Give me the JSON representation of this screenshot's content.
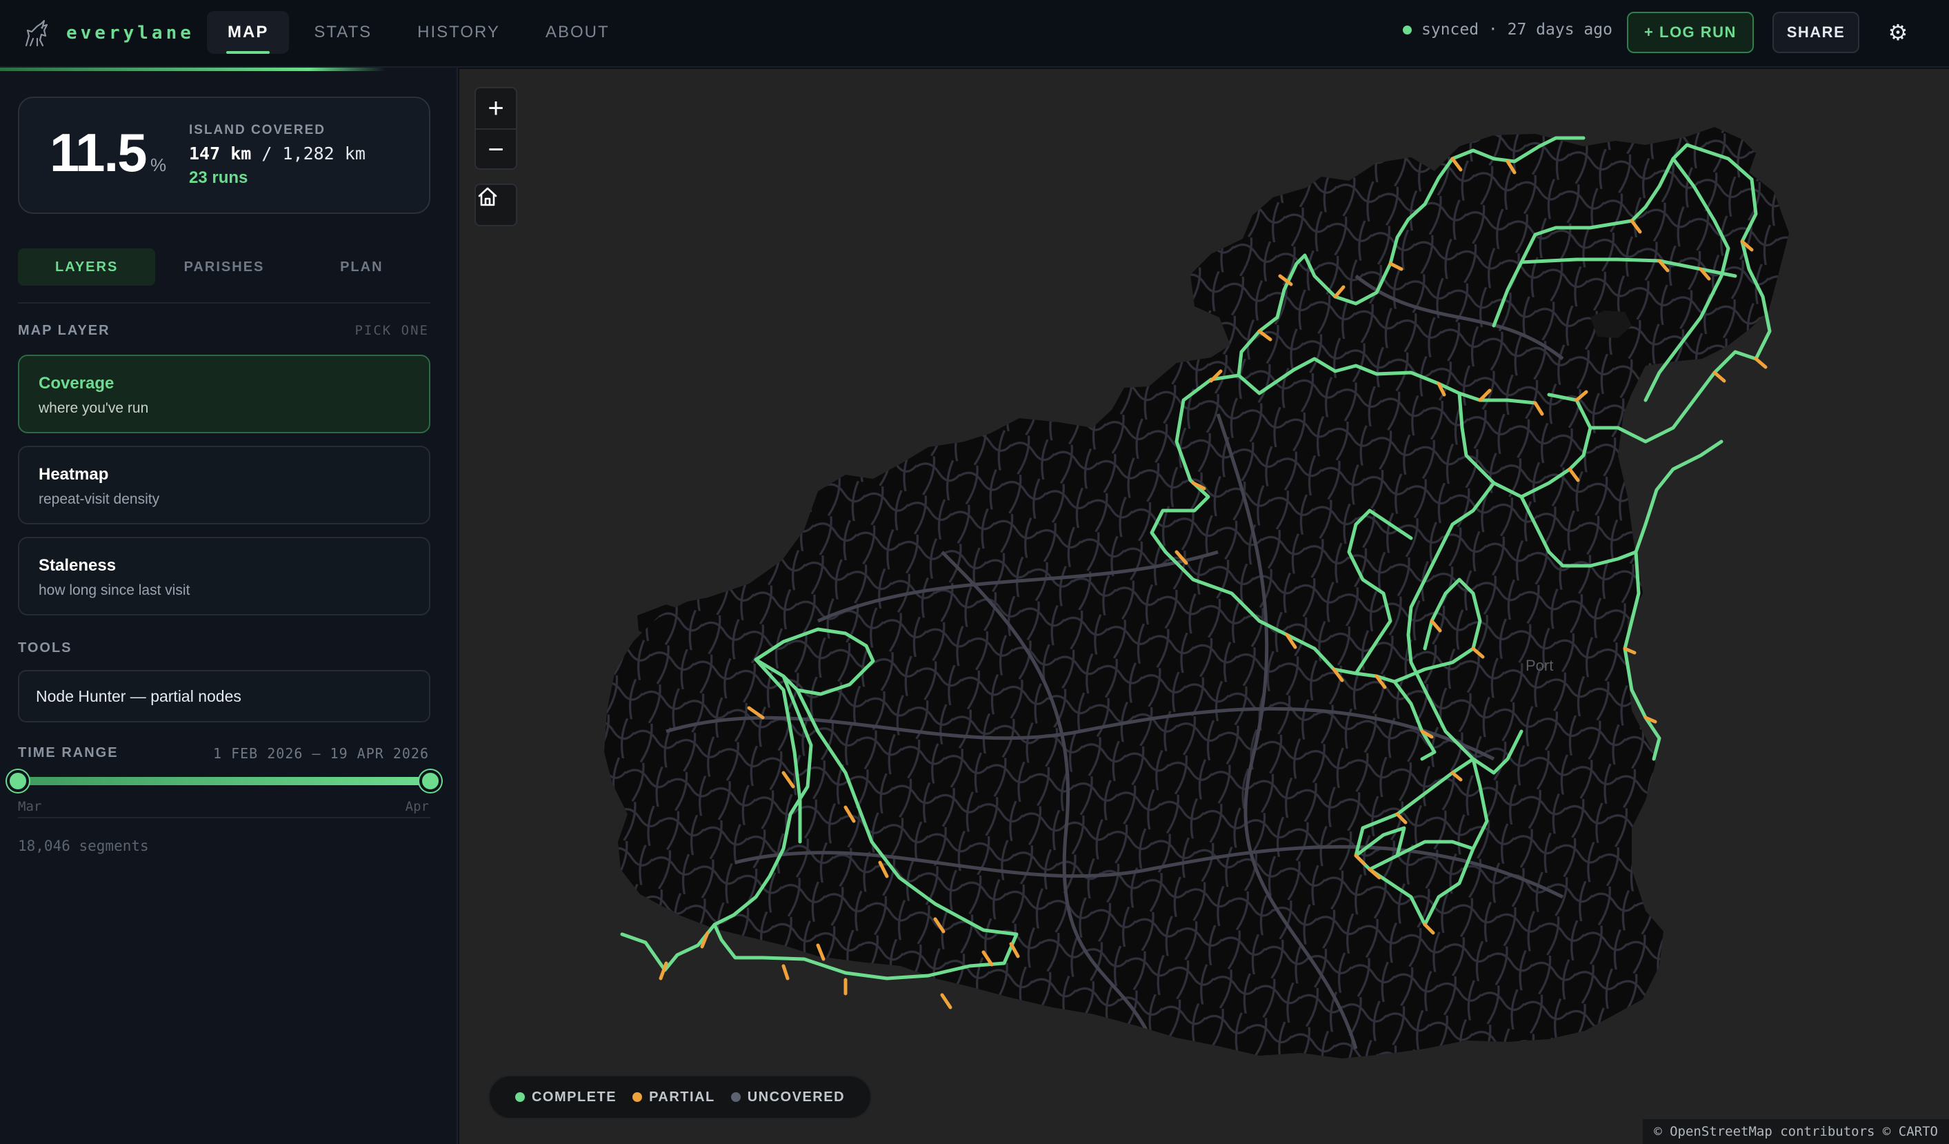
{
  "brand": {
    "name": "everylane",
    "logo_icon": "goat-icon",
    "accent": "#6ddc8f"
  },
  "nav": {
    "tabs": [
      {
        "label": "MAP",
        "active": true
      },
      {
        "label": "STATS",
        "active": false
      },
      {
        "label": "HISTORY",
        "active": false
      },
      {
        "label": "ABOUT",
        "active": false
      }
    ]
  },
  "header": {
    "sync_status": "synced · 27 days ago",
    "log_run_label": "+ LOG RUN",
    "share_label": "SHARE",
    "settings_icon": "gear-icon"
  },
  "coverage": {
    "percent": "11.5",
    "percent_sign": "%",
    "label": "ISLAND COVERED",
    "km_done": "147 km",
    "km_total": "/ 1,282 km",
    "runs": "23 runs"
  },
  "subtabs": [
    {
      "label": "LAYERS",
      "active": true
    },
    {
      "label": "PARISHES",
      "active": false
    },
    {
      "label": "PLAN",
      "active": false
    }
  ],
  "map_layer": {
    "label": "MAP LAYER",
    "hint": "PICK ONE",
    "options": [
      {
        "title": "Coverage",
        "desc": "where you've run",
        "active": true
      },
      {
        "title": "Heatmap",
        "desc": "repeat-visit density",
        "active": false
      },
      {
        "title": "Staleness",
        "desc": "how long since last visit",
        "active": false
      }
    ]
  },
  "tools": {
    "label": "TOOLS",
    "items": [
      {
        "label": "Node Hunter — partial nodes"
      }
    ]
  },
  "time_range": {
    "label": "TIME RANGE",
    "dates": "1 FEB 2026 — 19 APR 2026",
    "start_fraction": 0,
    "end_fraction": 1,
    "tick_start": "Mar",
    "tick_end": "Apr"
  },
  "segments": "18,046 segments",
  "map": {
    "zoom_in": "+",
    "zoom_out": "−",
    "home_icon": "home-icon",
    "place_label": "Port",
    "legend": [
      {
        "label": "COMPLETE",
        "color": "#6ddc8f"
      },
      {
        "label": "PARTIAL",
        "color": "#f0a23b"
      },
      {
        "label": "UNCOVERED",
        "color": "#5c6270"
      }
    ],
    "attribution": "© OpenStreetMap contributors © CARTO",
    "colors": {
      "land": "#0b0b0b",
      "water": "#242424",
      "road": "#3a3b48"
    }
  }
}
